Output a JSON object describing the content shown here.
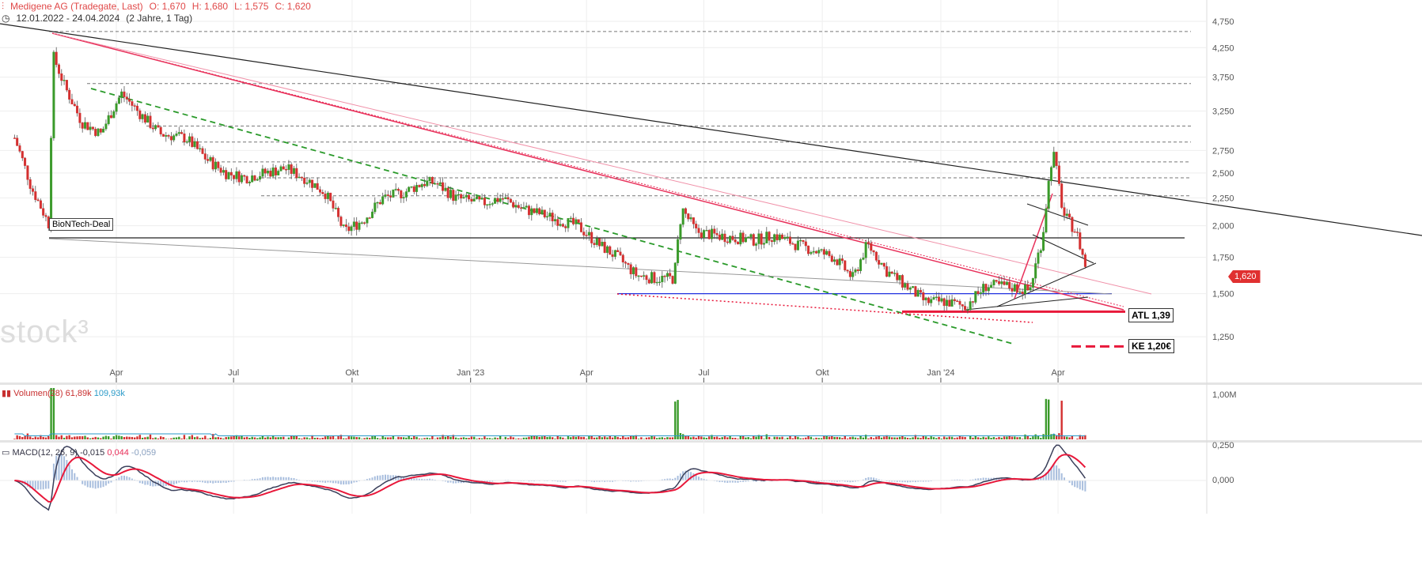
{
  "header": {
    "title": "Medigene AG (Tradegate, Last)",
    "open": "O: 1,670",
    "high": "H: 1,680",
    "low": "L: 1,575",
    "close": "C: 1,620",
    "range": "12.01.2022 - 24.04.2024",
    "range_note": "(2 Jahre, 1 Tag)"
  },
  "watermark": "stock³",
  "annotations": {
    "biontech": "BioNTech-Deal",
    "atl": "ATL 1,39",
    "ke": "KE 1,20€",
    "last_price": "1,620"
  },
  "volume_legend": {
    "label": "Volumen(28)",
    "v1": "61,89k",
    "v2": "109,93k",
    "axis": "1,00M"
  },
  "macd_legend": {
    "label": "MACD(12, 26, 9)",
    "v1": "-0,015",
    "v2": "0,044",
    "v3": "-0,059",
    "axis": [
      "0,250",
      "0,000"
    ]
  },
  "colors": {
    "up": "#3a9a2a",
    "down": "#d43030",
    "accent": "#e8305a"
  },
  "chart_data": {
    "type": "candlestick",
    "title": "Medigene AG (Tradegate, Last)",
    "y_scale": "log",
    "ylim": [
      1.1,
      4.9
    ],
    "y_ticks": [
      "4,750",
      "4,250",
      "3,750",
      "3,250",
      "2,750",
      "2,500",
      "2,250",
      "2,000",
      "1,750",
      "1,500",
      "1,250"
    ],
    "y_tick_values": [
      4.75,
      4.25,
      3.75,
      3.25,
      2.75,
      2.5,
      2.25,
      2.0,
      1.75,
      1.5,
      1.25
    ],
    "x_ticks": [
      {
        "label": "Apr",
        "date": "2022-04-01"
      },
      {
        "label": "Jul",
        "date": "2022-07-01"
      },
      {
        "label": "Okt",
        "date": "2022-10-01"
      },
      {
        "label": "Jan '23",
        "date": "2023-01-01"
      },
      {
        "label": "Apr",
        "date": "2023-04-01"
      },
      {
        "label": "Jul",
        "date": "2023-07-01"
      },
      {
        "label": "Okt",
        "date": "2023-10-01"
      },
      {
        "label": "Jan '24",
        "date": "2024-01-01"
      },
      {
        "label": "Apr",
        "date": "2024-04-01"
      }
    ],
    "closes": [
      [
        "2022-01-12",
        2.9
      ],
      [
        "2022-01-25",
        2.35
      ],
      [
        "2022-02-08",
        2.0
      ],
      [
        "2022-02-11",
        4.1
      ],
      [
        "2022-02-20",
        3.6
      ],
      [
        "2022-03-05",
        3.1
      ],
      [
        "2022-03-20",
        2.95
      ],
      [
        "2022-04-05",
        3.5
      ],
      [
        "2022-04-20",
        3.2
      ],
      [
        "2022-05-05",
        2.95
      ],
      [
        "2022-05-25",
        2.9
      ],
      [
        "2022-06-10",
        2.65
      ],
      [
        "2022-06-25",
        2.5
      ],
      [
        "2022-07-10",
        2.45
      ],
      [
        "2022-07-25",
        2.5
      ],
      [
        "2022-08-10",
        2.55
      ],
      [
        "2022-08-25",
        2.45
      ],
      [
        "2022-09-10",
        2.3
      ],
      [
        "2022-09-25",
        1.95
      ],
      [
        "2022-10-10",
        2.05
      ],
      [
        "2022-10-25",
        2.25
      ],
      [
        "2022-11-10",
        2.3
      ],
      [
        "2022-11-25",
        2.4
      ],
      [
        "2022-12-05",
        2.4
      ],
      [
        "2022-12-20",
        2.25
      ],
      [
        "2023-01-10",
        2.2
      ],
      [
        "2023-01-25",
        2.25
      ],
      [
        "2023-02-10",
        2.15
      ],
      [
        "2023-02-25",
        2.1
      ],
      [
        "2023-03-10",
        2.05
      ],
      [
        "2023-03-25",
        2.0
      ],
      [
        "2023-04-10",
        1.85
      ],
      [
        "2023-04-25",
        1.75
      ],
      [
        "2023-05-10",
        1.62
      ],
      [
        "2023-05-25",
        1.6
      ],
      [
        "2023-06-08",
        1.6
      ],
      [
        "2023-06-14",
        2.15
      ],
      [
        "2023-06-25",
        1.95
      ],
      [
        "2023-07-10",
        1.92
      ],
      [
        "2023-07-25",
        1.9
      ],
      [
        "2023-08-10",
        1.88
      ],
      [
        "2023-08-25",
        1.92
      ],
      [
        "2023-09-10",
        1.85
      ],
      [
        "2023-09-25",
        1.8
      ],
      [
        "2023-10-10",
        1.75
      ],
      [
        "2023-10-25",
        1.6
      ],
      [
        "2023-11-05",
        1.85
      ],
      [
        "2023-11-20",
        1.65
      ],
      [
        "2023-12-05",
        1.55
      ],
      [
        "2023-12-20",
        1.45
      ],
      [
        "2024-01-05",
        1.45
      ],
      [
        "2024-01-20",
        1.42
      ],
      [
        "2024-02-05",
        1.55
      ],
      [
        "2024-02-20",
        1.55
      ],
      [
        "2024-03-10",
        1.52
      ],
      [
        "2024-03-20",
        1.9
      ],
      [
        "2024-03-28",
        2.75
      ],
      [
        "2024-04-05",
        2.1
      ],
      [
        "2024-04-15",
        1.95
      ],
      [
        "2024-04-24",
        1.62
      ]
    ],
    "horizontal_levels": [
      4.55,
      3.65,
      3.05,
      2.85,
      2.62,
      2.45,
      2.27,
      1.9,
      1.5,
      1.39,
      1.2
    ]
  }
}
